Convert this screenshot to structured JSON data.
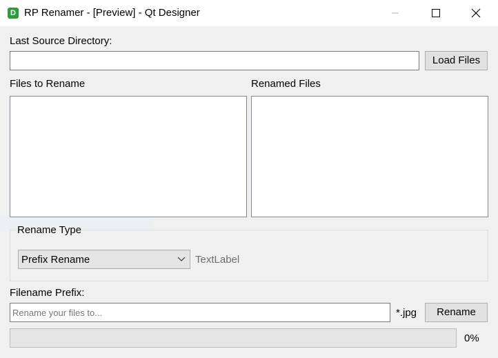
{
  "window": {
    "title": "RP Renamer - [Preview] - Qt Designer",
    "app_icon_letter": "D"
  },
  "source": {
    "label": "Last Source Directory:",
    "value": "",
    "load_button": "Load Files"
  },
  "lists": {
    "files_label": "Files to Rename",
    "renamed_label": "Renamed Files"
  },
  "rename_type": {
    "group_label": "Rename Type",
    "selected": "Prefix Rename",
    "text_label": "TextLabel"
  },
  "prefix": {
    "label": "Filename Prefix:",
    "placeholder": "Rename your files to...",
    "value": "",
    "extension": "*.jpg",
    "rename_button": "Rename"
  },
  "progress": {
    "value_percent": 0,
    "label": "0%"
  }
}
